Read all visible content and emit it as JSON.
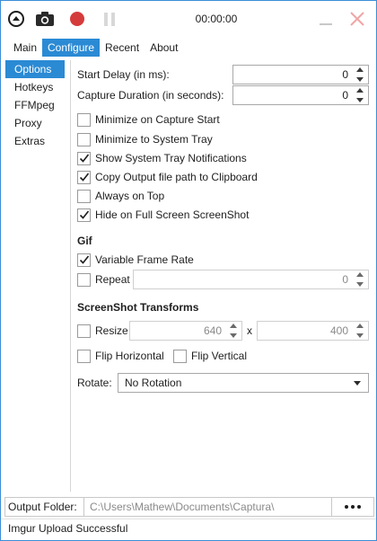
{
  "toolbar": {
    "timer": "00:00:00",
    "icons": [
      "collapse-up-icon",
      "camera-icon",
      "record-icon",
      "pause-icon",
      "minimize-icon",
      "close-icon"
    ],
    "colors": {
      "record": "#d53b3b",
      "close": "#f0a6a6",
      "accent": "#2b8ad4"
    }
  },
  "tabs": [
    {
      "label": "Main",
      "active": false
    },
    {
      "label": "Configure",
      "active": true
    },
    {
      "label": "Recent",
      "active": false
    },
    {
      "label": "About",
      "active": false
    }
  ],
  "sidebar": {
    "items": [
      {
        "label": "Options",
        "active": true
      },
      {
        "label": "Hotkeys",
        "active": false
      },
      {
        "label": "FFMpeg",
        "active": false
      },
      {
        "label": "Proxy",
        "active": false
      },
      {
        "label": "Extras",
        "active": false
      }
    ]
  },
  "options": {
    "start_delay": {
      "label": "Start Delay (in ms):",
      "value": "0"
    },
    "capture_duration": {
      "label": "Capture Duration (in seconds):",
      "value": "0"
    },
    "checkboxes": [
      {
        "label": "Minimize on Capture Start",
        "checked": false
      },
      {
        "label": "Minimize to System Tray",
        "checked": false
      },
      {
        "label": "Show System Tray Notifications",
        "checked": true
      },
      {
        "label": "Copy Output file path to Clipboard",
        "checked": true
      },
      {
        "label": "Always on Top",
        "checked": false
      },
      {
        "label": "Hide on Full Screen ScreenShot",
        "checked": true
      }
    ]
  },
  "gif": {
    "title": "Gif",
    "variable_frame_rate": {
      "label": "Variable Frame Rate",
      "checked": true
    },
    "repeat": {
      "label": "Repeat",
      "checked": false,
      "value": "0"
    }
  },
  "transforms": {
    "title": "ScreenShot Transforms",
    "resize": {
      "label": "Resize",
      "checked": false,
      "width": "640",
      "separator": "x",
      "height": "400"
    },
    "flip_horizontal": {
      "label": "Flip Horizontal",
      "checked": false
    },
    "flip_vertical": {
      "label": "Flip Vertical",
      "checked": false
    },
    "rotate": {
      "label": "Rotate:",
      "value": "No Rotation"
    }
  },
  "output": {
    "label": "Output Folder:",
    "path": "C:\\Users\\Mathew\\Documents\\Captura\\"
  },
  "status": "Imgur Upload Successful"
}
